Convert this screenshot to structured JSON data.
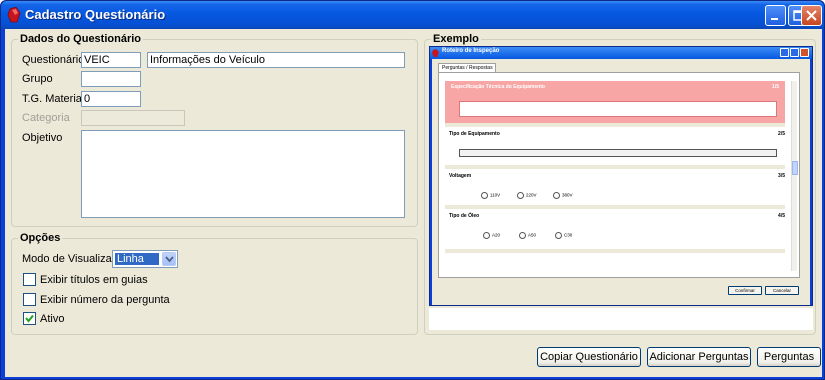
{
  "window": {
    "title": "Cadastro Questionário"
  },
  "dados": {
    "legend": "Dados do Questionário",
    "questionario_label": "Questionário",
    "questionario_code": "VEIC",
    "questionario_desc": "Informações do Veículo",
    "grupo_label": "Grupo",
    "grupo_value": "",
    "tg_material_label": "T.G. Material",
    "tg_material_value": "0",
    "categoria_label": "Categoria",
    "categoria_value": "",
    "objetivo_label": "Objetivo",
    "objetivo_value": ""
  },
  "opcoes": {
    "legend": "Opções",
    "modo_label": "Modo de Visualização",
    "modo_value": "Linha",
    "exibir_titulos_label": "Exibir títulos em guias",
    "exibir_titulos_checked": false,
    "exibir_numero_label": "Exibir número da pergunta",
    "exibir_numero_checked": false,
    "ativo_label": "Ativo",
    "ativo_checked": true
  },
  "exemplo": {
    "legend": "Exemplo",
    "window_title": "Roteiro de Inspeção",
    "tab_label": "Perguntas / Respostas",
    "questions": [
      {
        "title": "Especificação Técnica do Equipamento",
        "number": "1/5"
      },
      {
        "title": "Tipo de Equipamento",
        "number": "2/5"
      },
      {
        "title": "Voltagem",
        "number": "3/5",
        "options": [
          "110V",
          "220V",
          "380V"
        ]
      },
      {
        "title": "Tipo de Óleo",
        "number": "4/5",
        "options": [
          "A20",
          "A50",
          "C30"
        ]
      }
    ],
    "confirm_label": "Confirmar",
    "cancel_label": "Cancelar"
  },
  "buttons": {
    "copiar": "Copiar Questionário",
    "adicionar": "Adicionar Perguntas",
    "perguntas": "Perguntas"
  },
  "colors": {
    "titlebar": "#0758e0",
    "client_bg": "#ece9d8",
    "selected_question": "#f7a5a5",
    "selection": "#316ac5"
  }
}
